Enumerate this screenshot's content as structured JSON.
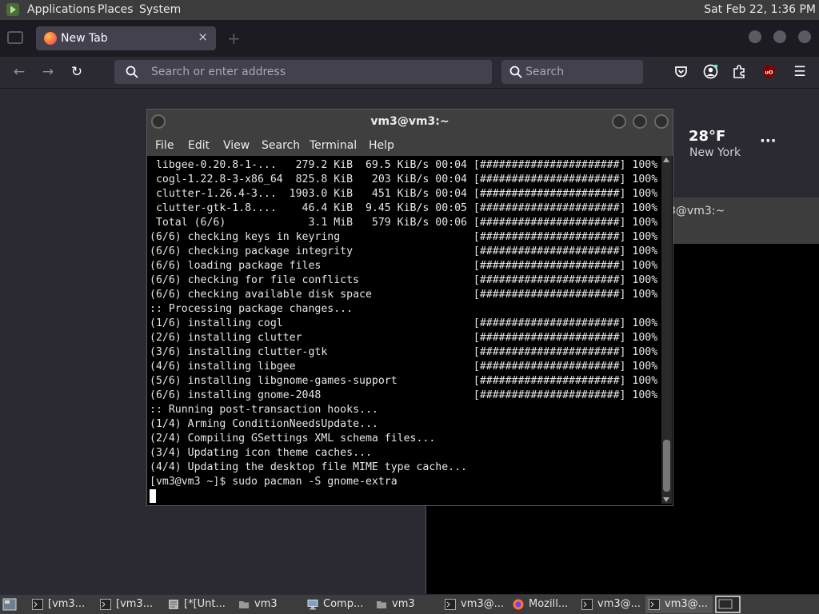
{
  "top_panel": {
    "menus": [
      "Applications",
      "Places",
      "System"
    ],
    "clock": "Sat Feb 22, 1:36 PM"
  },
  "browser": {
    "tab_title": "New Tab",
    "tab_close": "×",
    "url_placeholder": "Search or enter address",
    "search_placeholder": "Search",
    "weather": {
      "temp": "28°F",
      "city": "New York",
      "more": "···"
    }
  },
  "bg_terminal": {
    "title": "3@vm3:~"
  },
  "terminal": {
    "title": "vm3@vm3:~",
    "menu": [
      "File",
      "Edit",
      "View",
      "Search",
      "Terminal",
      "Help"
    ],
    "lines": [
      " libgee-0.20.8-1-...   279.2 KiB  69.5 KiB/s 00:04 [######################] 100%",
      " cogl-1.22.8-3-x86_64  825.8 KiB   203 KiB/s 00:04 [######################] 100%",
      " clutter-1.26.4-3...  1903.0 KiB   451 KiB/s 00:04 [######################] 100%",
      " clutter-gtk-1.8....    46.4 KiB  9.45 KiB/s 00:05 [######################] 100%",
      " Total (6/6)             3.1 MiB   579 KiB/s 00:06 [######################] 100%",
      "(6/6) checking keys in keyring                     [######################] 100%",
      "(6/6) checking package integrity                   [######################] 100%",
      "(6/6) loading package files                        [######################] 100%",
      "(6/6) checking for file conflicts                  [######################] 100%",
      "(6/6) checking available disk space                [######################] 100%",
      ":: Processing package changes...",
      "(1/6) installing cogl                              [######################] 100%",
      "(2/6) installing clutter                           [######################] 100%",
      "(3/6) installing clutter-gtk                       [######################] 100%",
      "(4/6) installing libgee                            [######################] 100%",
      "(5/6) installing libgnome-games-support            [######################] 100%",
      "(6/6) installing gnome-2048                        [######################] 100%",
      ":: Running post-transaction hooks...",
      "(1/4) Arming ConditionNeedsUpdate...",
      "(2/4) Compiling GSettings XML schema files...",
      "(3/4) Updating icon theme caches...",
      "(4/4) Updating the desktop file MIME type cache...",
      "[vm3@vm3 ~]$ sudo pacman -S gnome-extra"
    ]
  },
  "taskbar": {
    "items": [
      {
        "label": "[vm3...",
        "icon": "terminal-icon"
      },
      {
        "label": "[vm3...",
        "icon": "terminal-icon"
      },
      {
        "label": "[*[Unt...",
        "icon": "text-editor-icon"
      },
      {
        "label": "vm3",
        "icon": "folder-icon"
      },
      {
        "label": "Comp...",
        "icon": "computer-icon"
      },
      {
        "label": "vm3",
        "icon": "folder-icon"
      },
      {
        "label": "vm3@...",
        "icon": "terminal-icon"
      },
      {
        "label": "Mozill...",
        "icon": "firefox-icon"
      },
      {
        "label": "vm3@...",
        "icon": "terminal-icon"
      },
      {
        "label": "vm3@...",
        "icon": "terminal-icon"
      }
    ]
  },
  "colors": {
    "accent_firefox": "#ff7139",
    "panel_bg": "#3c3c3c",
    "terminal_bg": "#000000"
  }
}
